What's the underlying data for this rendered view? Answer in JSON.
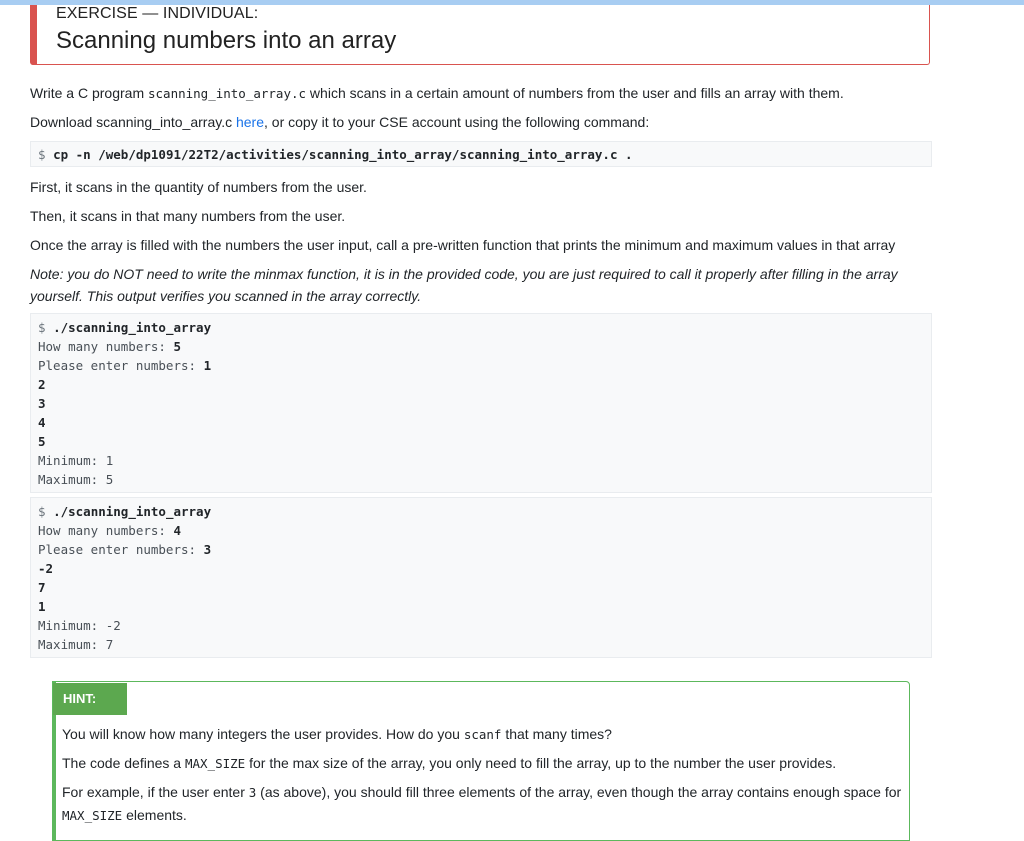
{
  "exercise": {
    "label": "EXERCISE — INDIVIDUAL:",
    "title": "Scanning numbers into an array"
  },
  "intro": {
    "pre": "Write a C program ",
    "filename": "scanning_into_array.c",
    "post": " which scans in a certain amount of numbers from the user and fills an array with them."
  },
  "download": {
    "pre": "Download scanning_into_array.c ",
    "link": "here",
    "post": ", or copy it to your CSE account using the following command:"
  },
  "command": {
    "prompt": "$ ",
    "text": "cp -n /web/dp1091/22T2/activities/scanning_into_array/scanning_into_array.c ."
  },
  "para_first": "First, it scans in the quantity of numbers from the user.",
  "para_then": "Then, it scans in that many numbers from the user.",
  "para_once": "Once the array is filled with the numbers the user input, call a pre-written function that prints the minimum and maximum values in that array",
  "note": "Note: you do NOT need to write the minmax function, it is in the provided code, you are just required to call it properly after filling in the array yourself. This output verifies you scanned in the array correctly.",
  "example1": {
    "prompt": "$ ",
    "command": "./scanning_into_array",
    "how_many_label": "How many numbers: ",
    "how_many_value": "5",
    "enter_label": "Please enter numbers: ",
    "first_input": "1",
    "inputs": [
      "2",
      "3",
      "4",
      "5"
    ],
    "minimum": "Minimum: 1",
    "maximum": "Maximum: 5"
  },
  "example2": {
    "prompt": "$ ",
    "command": "./scanning_into_array",
    "how_many_label": "How many numbers: ",
    "how_many_value": "4",
    "enter_label": "Please enter numbers: ",
    "first_input": "3",
    "inputs": [
      "-2",
      "7",
      "1"
    ],
    "minimum": "Minimum: -2",
    "maximum": "Maximum: 7"
  },
  "hint": {
    "badge": "HINT:",
    "p1_pre": "You will know how many integers the user provides. How do you ",
    "p1_code": "scanf",
    "p1_post": " that many times?",
    "p2_pre": "The code defines a ",
    "p2_code": "MAX_SIZE",
    "p2_post": " for the max size of the array, you only need to fill the array, up to the number the user provides.",
    "p3_pre": "For example, if the user enter ",
    "p3_code": "3",
    "p3_mid": " (as above), you should fill three elements of the array, even though the array contains enough space for ",
    "p3_code2": "MAX_SIZE",
    "p3_post": " elements."
  }
}
